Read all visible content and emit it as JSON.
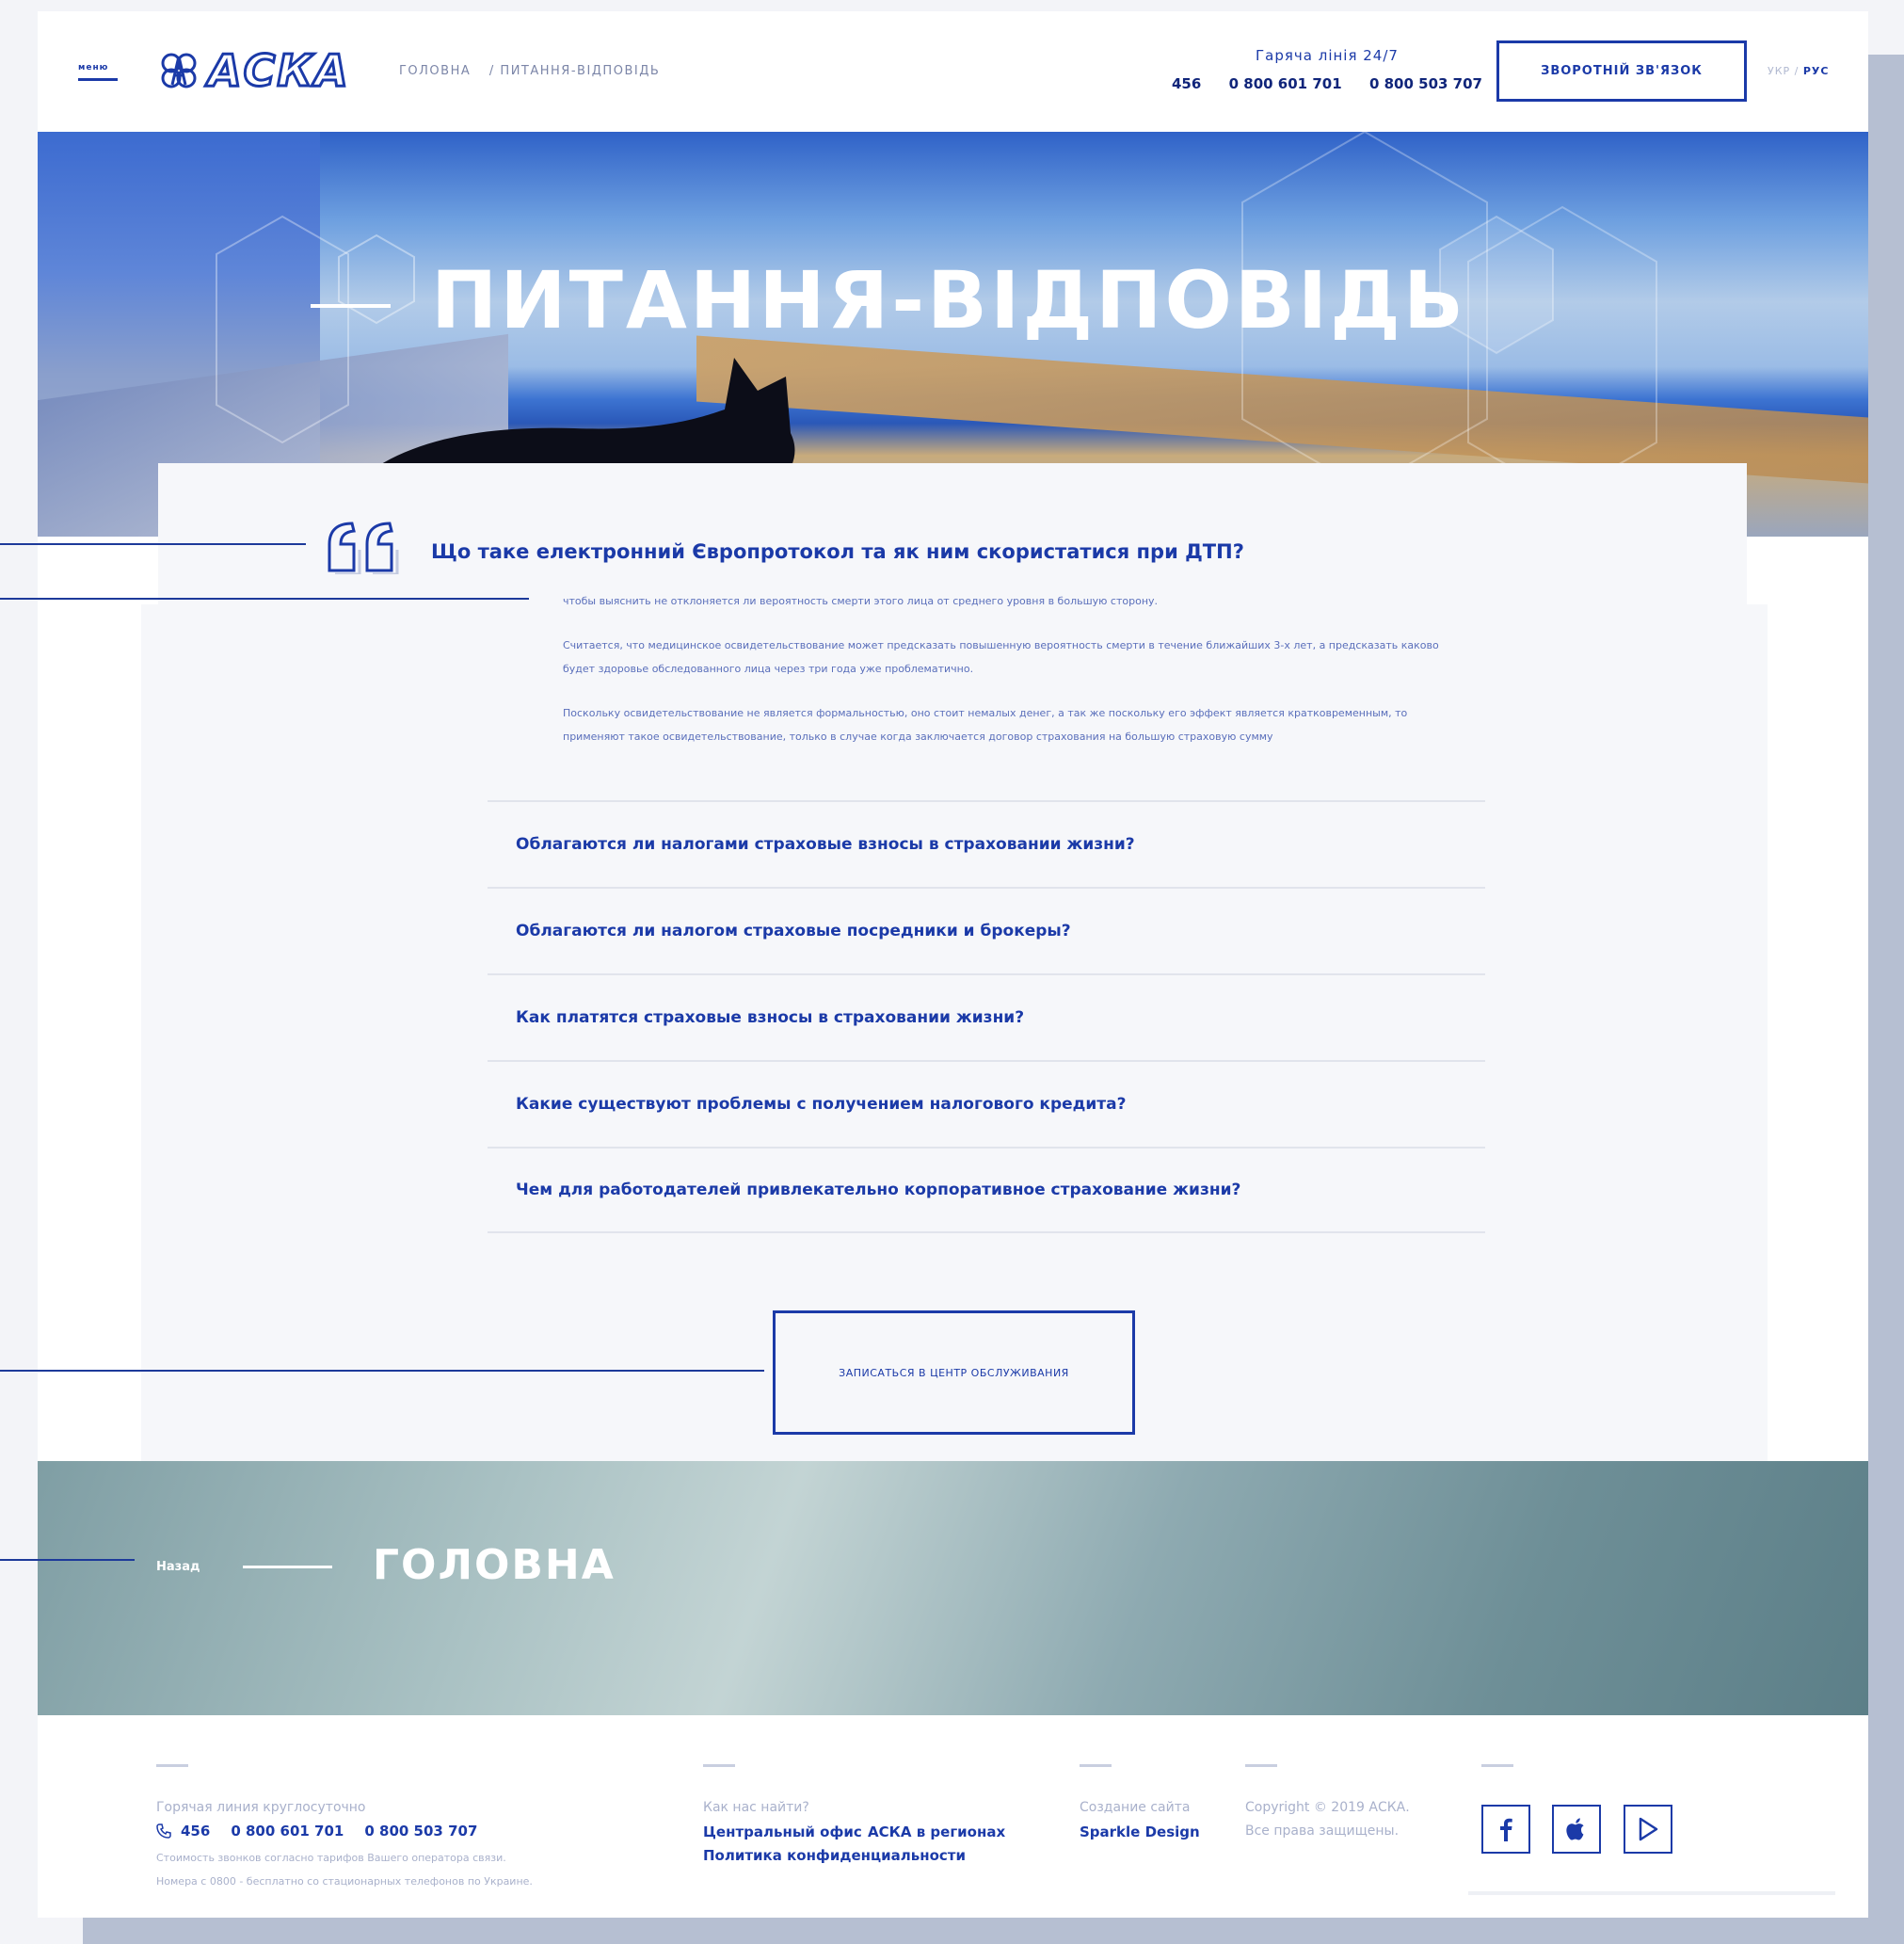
{
  "header": {
    "menu_label": "меню",
    "logo_text": "АСКА",
    "breadcrumb": [
      "ГОЛОВНА",
      "/ ПИТАННЯ-ВІДПОВІДЬ"
    ],
    "hotline_title": "Гаряча лінія 24/7",
    "hotline_numbers": [
      "456",
      "0 800 601 701",
      "0 800 503 707"
    ],
    "callback_label": "ЗВОРОТНІЙ ЗВ'ЯЗОК",
    "lang_ukr": "УКР /",
    "lang_rus": "РУС"
  },
  "hero": {
    "title": "ПИТАННЯ-ВІДПОВІДЬ"
  },
  "faq": {
    "open_question": "Що таке електронний Європротокол та як ним скористатися при ДТП?",
    "answer_paragraphs": [
      "чтобы выяснить не отклоняется ли вероятность смерти этого лица от среднего уровня в большую сторону.",
      "Считается, что медицинское освидетельствование может предсказать повышенную вероятность смерти в течение ближайших 3-х лет, а предсказать каково будет здоровье обследованного лица через три года уже проблематично.",
      "Поскольку освидетельствование не является формальностью, оно стоит немалых денег, а так же поскольку его эффект является кратковременным, то применяют такое освидетельствование, только в случае когда заключается договор страхования на большую страховую сумму"
    ],
    "questions": [
      "Облагаются ли налогами страховые взносы в страховании жизни?",
      "Облагаются ли налогом страховые посредники и брокеры?",
      "Как платятся страховые взносы в страховании жизни?",
      "Какие существуют проблемы с получением налогового кредита?",
      "Чем для работодателей привлекательно корпоративное страхование жизни?"
    ],
    "appointment_label": "ЗАПИСАТЬСЯ В ЦЕНТР ОБСЛУЖИВАНИЯ"
  },
  "back": {
    "label": "Назад",
    "title": "ГОЛОВНА"
  },
  "footer": {
    "hotline_title": "Горячая линия круглосуточно",
    "numbers": [
      "456",
      "0 800 601 701",
      "0 800 503 707"
    ],
    "note_1": "Стоимость звонков согласно тарифов Вашего оператора связи.",
    "note_2": "Номера с 0800 - бесплатно со стационарных телефонов по Украине.",
    "find_title": "Как нас найти?",
    "central_office": "Центральный офис",
    "regions": "АСКА в регионах",
    "privacy": "Политика конфиденциальности",
    "site_created_title": "Создание сайта",
    "site_created_by": "Sparkle Design",
    "copyright": "Copyright © 2019 АСКА.",
    "rights": "Все права защищены."
  },
  "icons": {
    "phone": "phone-icon",
    "facebook": "facebook-icon",
    "apple": "apple-icon",
    "play": "google-play-icon",
    "quote": "quote-icon"
  },
  "colors": {
    "brand_blue": "#1b3aa8",
    "muted": "#a9b1cb"
  }
}
